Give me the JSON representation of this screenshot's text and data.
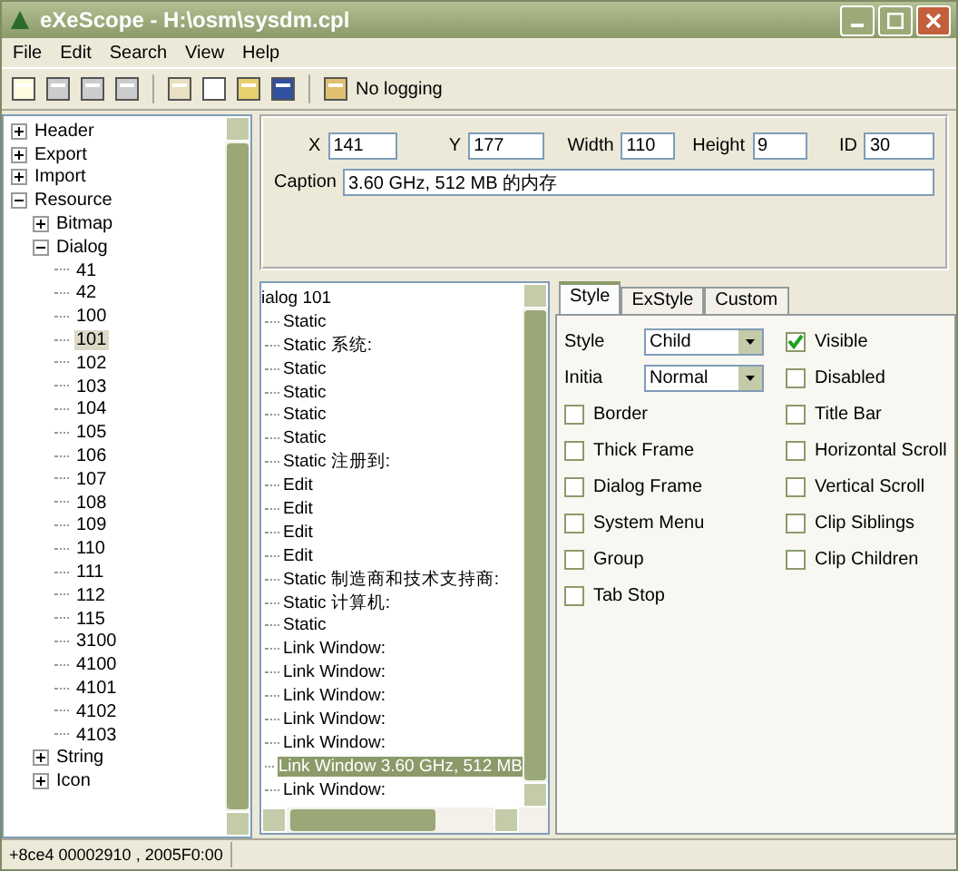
{
  "window": {
    "title": "eXeScope - H:\\osm\\sysdm.cpl"
  },
  "menu": [
    "File",
    "Edit",
    "Search",
    "View",
    "Help"
  ],
  "toolbar": {
    "logging_label": "No logging"
  },
  "tree": [
    {
      "label": "Header",
      "expanded": false
    },
    {
      "label": "Export",
      "expanded": false
    },
    {
      "label": "Import",
      "expanded": false
    },
    {
      "label": "Resource",
      "expanded": true,
      "children": [
        {
          "label": "Bitmap",
          "expanded": false
        },
        {
          "label": "Dialog",
          "expanded": true,
          "children": [
            {
              "label": "41",
              "selected": false
            },
            {
              "label": "42",
              "selected": false
            },
            {
              "label": "100",
              "selected": false
            },
            {
              "label": "101",
              "selected": true
            },
            {
              "label": "102",
              "selected": false
            },
            {
              "label": "103",
              "selected": false
            },
            {
              "label": "104",
              "selected": false
            },
            {
              "label": "105",
              "selected": false
            },
            {
              "label": "106",
              "selected": false
            },
            {
              "label": "107",
              "selected": false
            },
            {
              "label": "108",
              "selected": false
            },
            {
              "label": "109",
              "selected": false
            },
            {
              "label": "110",
              "selected": false
            },
            {
              "label": "111",
              "selected": false
            },
            {
              "label": "112",
              "selected": false
            },
            {
              "label": "115",
              "selected": false
            },
            {
              "label": "3100",
              "selected": false
            },
            {
              "label": "4100",
              "selected": false
            },
            {
              "label": "4101",
              "selected": false
            },
            {
              "label": "4102",
              "selected": false
            },
            {
              "label": "4103",
              "selected": false
            }
          ]
        },
        {
          "label": "String",
          "expanded": false
        },
        {
          "label": "Icon",
          "expanded": false
        }
      ]
    }
  ],
  "properties": {
    "x": {
      "label": "X",
      "value": "141"
    },
    "y": {
      "label": "Y",
      "value": "177"
    },
    "width": {
      "label": "Width",
      "value": "110"
    },
    "height": {
      "label": "Height",
      "value": "9"
    },
    "id": {
      "label": "ID",
      "value": "30"
    },
    "caption": {
      "label": "Caption",
      "value": "3.60 GHz, 512 MB 的内存"
    }
  },
  "controls": [
    {
      "label": "ialog 101",
      "selected": false
    },
    {
      "label": "Static",
      "selected": false
    },
    {
      "label": "Static 系统:",
      "selected": false
    },
    {
      "label": "Static",
      "selected": false
    },
    {
      "label": "Static",
      "selected": false
    },
    {
      "label": "Static",
      "selected": false
    },
    {
      "label": "Static",
      "selected": false
    },
    {
      "label": "Static 注册到:",
      "selected": false
    },
    {
      "label": "Edit",
      "selected": false
    },
    {
      "label": "Edit",
      "selected": false
    },
    {
      "label": "Edit",
      "selected": false
    },
    {
      "label": "Edit",
      "selected": false
    },
    {
      "label": "Static 制造商和技术支持商:",
      "selected": false
    },
    {
      "label": "Static 计算机:",
      "selected": false
    },
    {
      "label": "Static",
      "selected": false
    },
    {
      "label": "Link Window:",
      "selected": false
    },
    {
      "label": "Link Window:",
      "selected": false
    },
    {
      "label": "Link Window:",
      "selected": false
    },
    {
      "label": "Link Window:",
      "selected": false
    },
    {
      "label": "Link Window:",
      "selected": false
    },
    {
      "label": "Link Window 3.60 GHz, 512 MB",
      "selected": true
    },
    {
      "label": "Link Window:",
      "selected": false
    }
  ],
  "tabs": [
    {
      "label": "Style",
      "selected": true
    },
    {
      "label": "ExStyle",
      "selected": false
    },
    {
      "label": "Custom",
      "selected": false
    }
  ],
  "dropdowns": [
    {
      "label": "Style",
      "value": "Child"
    },
    {
      "label": "Initia",
      "value": "Normal"
    }
  ],
  "checks_left": [
    {
      "label": "Border",
      "checked": false
    },
    {
      "label": "Thick Frame",
      "checked": false
    },
    {
      "label": "Dialog Frame",
      "checked": false
    },
    {
      "label": "System Menu",
      "checked": false
    },
    {
      "label": "Group",
      "checked": false
    },
    {
      "label": "Tab Stop",
      "checked": false
    }
  ],
  "checks_right": [
    {
      "label": "Visible",
      "checked": true
    },
    {
      "label": "Disabled",
      "checked": false
    },
    {
      "label": "Title Bar",
      "checked": false
    },
    {
      "label": "Horizontal Scroll",
      "checked": false
    },
    {
      "label": "Vertical Scroll",
      "checked": false
    },
    {
      "label": "Clip Siblings",
      "checked": false
    },
    {
      "label": "Clip Children",
      "checked": false
    }
  ],
  "status_bar": {
    "text": "+8ce4 00002910 , 2005F0:00"
  }
}
